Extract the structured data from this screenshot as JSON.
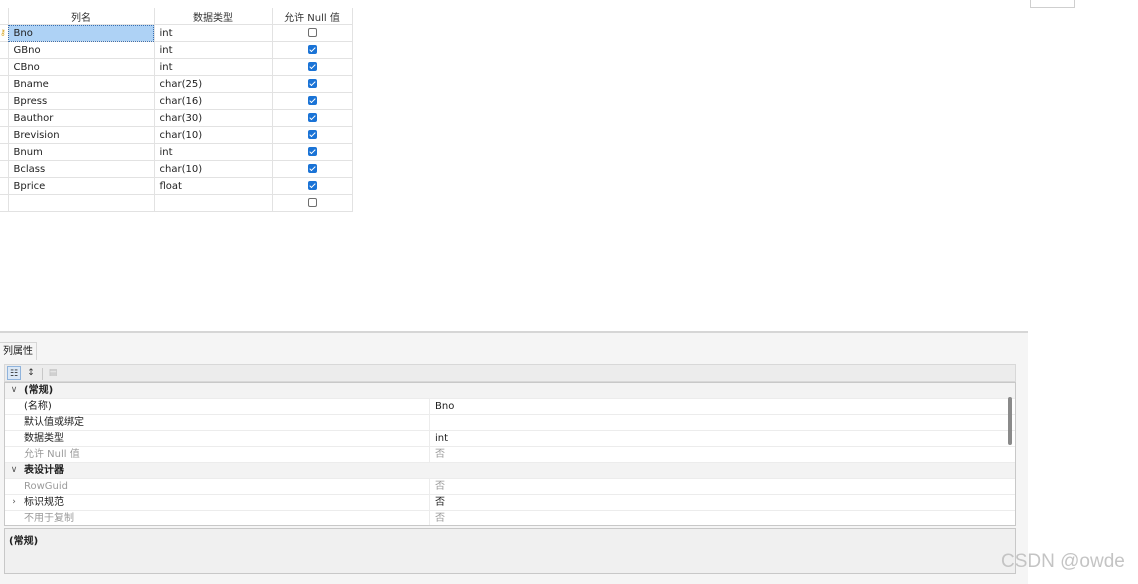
{
  "grid": {
    "headers": {
      "name": "列名",
      "type": "数据类型",
      "allow_null": "允许 Null 值"
    },
    "rows": [
      {
        "name": "Bno",
        "type": "int",
        "allow_null": false,
        "primary_key": true,
        "selected": true
      },
      {
        "name": "GBno",
        "type": "int",
        "allow_null": true
      },
      {
        "name": "CBno",
        "type": "int",
        "allow_null": true
      },
      {
        "name": "Bname",
        "type": "char(25)",
        "allow_null": true
      },
      {
        "name": "Bpress",
        "type": "char(16)",
        "allow_null": true
      },
      {
        "name": "Bauthor",
        "type": "char(30)",
        "allow_null": true
      },
      {
        "name": "Brevision",
        "type": "char(10)",
        "allow_null": true
      },
      {
        "name": "Bnum",
        "type": "int",
        "allow_null": true
      },
      {
        "name": "Bclass",
        "type": "char(10)",
        "allow_null": true
      },
      {
        "name": "Bprice",
        "type": "float",
        "allow_null": true
      },
      {
        "name": "",
        "type": "",
        "allow_null": false
      }
    ]
  },
  "props": {
    "tab_label": "列属性",
    "toolbar": {
      "categorized_icon": "categorized-icon",
      "alphabetical_icon": "sort-alphabetical-icon",
      "property_pages_icon": "property-pages-icon"
    },
    "rows": [
      {
        "kind": "category",
        "name": "(常规)",
        "value": "",
        "expander": "∨"
      },
      {
        "kind": "prop",
        "name": "(名称)",
        "value": "Bno"
      },
      {
        "kind": "prop",
        "name": "默认值或绑定",
        "value": ""
      },
      {
        "kind": "prop",
        "name": "数据类型",
        "value": "int"
      },
      {
        "kind": "prop",
        "name": "允许 Null 值",
        "value": "否",
        "dim": true
      },
      {
        "kind": "category",
        "name": "表设计器",
        "value": "",
        "expander": "∨"
      },
      {
        "kind": "prop",
        "name": "RowGuid",
        "value": "否",
        "dim": true
      },
      {
        "kind": "prop",
        "name": "标识规范",
        "value": "否",
        "expander": "›"
      },
      {
        "kind": "prop",
        "name": "不用于复制",
        "value": "否",
        "dim": true
      }
    ],
    "description_title": "(常规)"
  },
  "watermark": "CSDN @owde",
  "colors": {
    "selection": "#aed2f5",
    "checkbox_checked": "#1a73d6",
    "primary_key": "#d9a520"
  }
}
